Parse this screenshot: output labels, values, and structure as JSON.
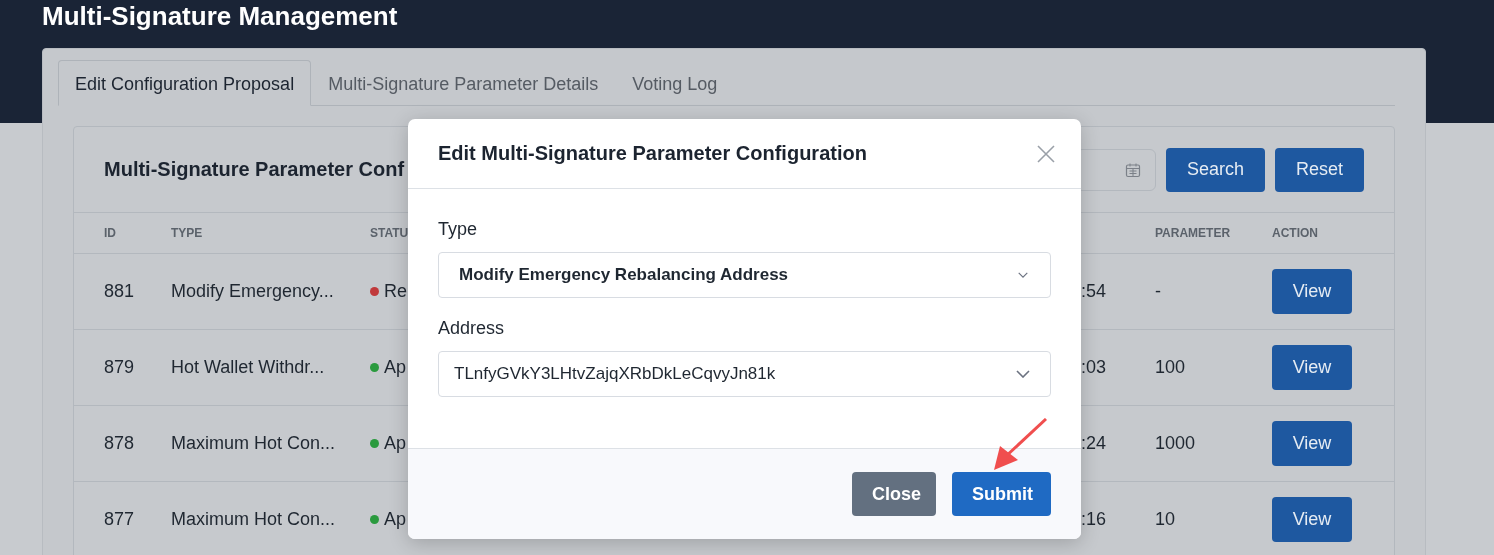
{
  "page_title": "Multi-Signature Management",
  "tabs": [
    {
      "label": "Edit Configuration Proposal",
      "selected": true
    },
    {
      "label": "Multi-Signature Parameter Details",
      "selected": false
    },
    {
      "label": "Voting Log",
      "selected": false
    }
  ],
  "card": {
    "title": "Multi-Signature Parameter Conf",
    "search_button": "Search",
    "reset_button": "Reset"
  },
  "table": {
    "columns": [
      "ID",
      "TYPE",
      "STATU",
      "PARAMETER",
      "ACTION"
    ],
    "rows": [
      {
        "id": "881",
        "type": "Modify Emergency...",
        "status": "Re",
        "color": "#c0393b",
        "time": ":54",
        "parameter": "-",
        "action": "View"
      },
      {
        "id": "879",
        "type": "Hot Wallet Withdr...",
        "status": "Ap",
        "color": "#2a9a3e",
        "time": ":03",
        "parameter": "100",
        "action": "View"
      },
      {
        "id": "878",
        "type": "Maximum Hot Con...",
        "status": "Ap",
        "color": "#2a9a3e",
        "time": ":24",
        "parameter": "1000",
        "action": "View"
      },
      {
        "id": "877",
        "type": "Maximum Hot Con...",
        "status": "Ap",
        "color": "#2a9a3e",
        "time": ":16",
        "parameter": "10",
        "action": "View"
      }
    ]
  },
  "dialog": {
    "title": "Edit Multi-Signature Parameter Configuration",
    "fields": [
      {
        "label": "Type",
        "value": "Modify Emergency Rebalancing Address",
        "bold": true
      },
      {
        "label": "Address",
        "value": "TLnfyGVkY3LHtvZajqXRbDkLeCqvyJn81k",
        "bold": false
      }
    ],
    "buttons": [
      {
        "label": "Close",
        "kind": "secondary"
      },
      {
        "label": "Submit",
        "kind": "primary"
      }
    ]
  }
}
